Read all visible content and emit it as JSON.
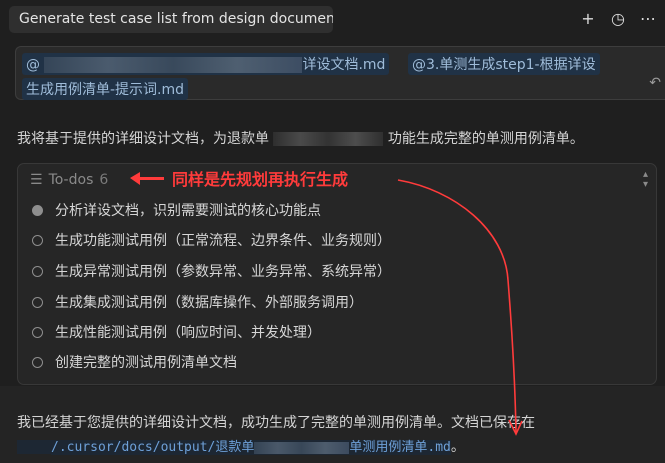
{
  "header": {
    "tab_title": "Generate test case list from design documents",
    "icons": [
      "plus-icon",
      "history-icon",
      "more-icon"
    ]
  },
  "input": {
    "chip1_prefix": "@",
    "chip1_suffix": "详设文档.md",
    "chip2": "@3.单测生成step1-根据详设",
    "chip2_line2": "生成用例清单-提示词.md"
  },
  "assistant": {
    "intro_before": "我将基于提供的详细设计文档，为退款单",
    "intro_after": "功能生成完整的单测用例清单。"
  },
  "todos": {
    "title": "To-dos",
    "count": "6",
    "items": [
      "分析详设文档，识别需要测试的核心功能点",
      "生成功能测试用例（正常流程、边界条件、业务规则）",
      "生成异常测试用例（参数异常、业务异常、系统异常）",
      "生成集成测试用例（数据库操作、外部服务调用）",
      "生成性能测试用例（响应时间、并发处理）",
      "创建完整的测试用例清单文档"
    ]
  },
  "annotation": "同样是先规划再执行生成",
  "result": {
    "line1": "我已经基于您提供的详细设计文档，成功生成了完整的单测用例清单。文档已保存在",
    "path_prefix": "/.cursor/docs/output/退款单",
    "path_suffix": "单测用例清单.md",
    "end": "。"
  },
  "colors": {
    "annotation_red": "#ff3b3b",
    "chip_bg": "#203246",
    "chip_text": "#9fbcd9"
  }
}
